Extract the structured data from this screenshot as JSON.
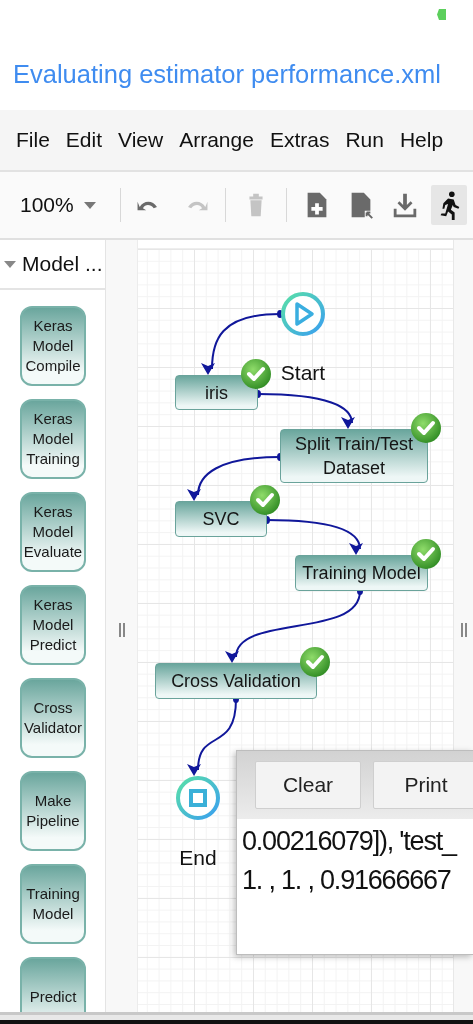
{
  "title": "Evaluating estimator performance.xml",
  "menu": [
    "File",
    "Edit",
    "View",
    "Arrange",
    "Extras",
    "Run",
    "Help"
  ],
  "toolbar": {
    "zoom": "100%",
    "tools": [
      {
        "kind": "undo",
        "disabled": false,
        "active": false
      },
      {
        "kind": "redo",
        "disabled": true,
        "active": false
      },
      {
        "kind": "delete",
        "disabled": true,
        "active": false
      },
      {
        "kind": "new",
        "disabled": false,
        "active": false
      },
      {
        "kind": "export",
        "disabled": false,
        "active": false
      },
      {
        "kind": "download",
        "disabled": false,
        "active": false
      },
      {
        "kind": "run",
        "disabled": false,
        "active": true
      }
    ]
  },
  "sidebar": {
    "section": "Model ...",
    "expanded": true,
    "items": [
      "Keras Model Compile",
      "Keras Model Training",
      "Keras Model Evaluate",
      "Keras Model Predict",
      "Cross Validator",
      "Make Pipeline",
      "Training Model",
      "Predict"
    ]
  },
  "diagram": {
    "nodes": [
      {
        "kind": "start",
        "label": "Start"
      },
      {
        "kind": "task",
        "label": "iris",
        "done": true
      },
      {
        "kind": "task",
        "label": "Split Train/Test Dataset",
        "done": true
      },
      {
        "kind": "task",
        "label": "SVC",
        "done": true
      },
      {
        "kind": "task",
        "label": "Training Model",
        "done": true
      },
      {
        "kind": "task",
        "label": "Cross Validation",
        "done": true
      },
      {
        "kind": "end",
        "label": "End"
      }
    ]
  },
  "console": {
    "buttons": [
      "Clear",
      "Print"
    ],
    "lines": [
      "0.00216079]), 'test_",
      "1. , 1. , 0.91666667"
    ]
  }
}
